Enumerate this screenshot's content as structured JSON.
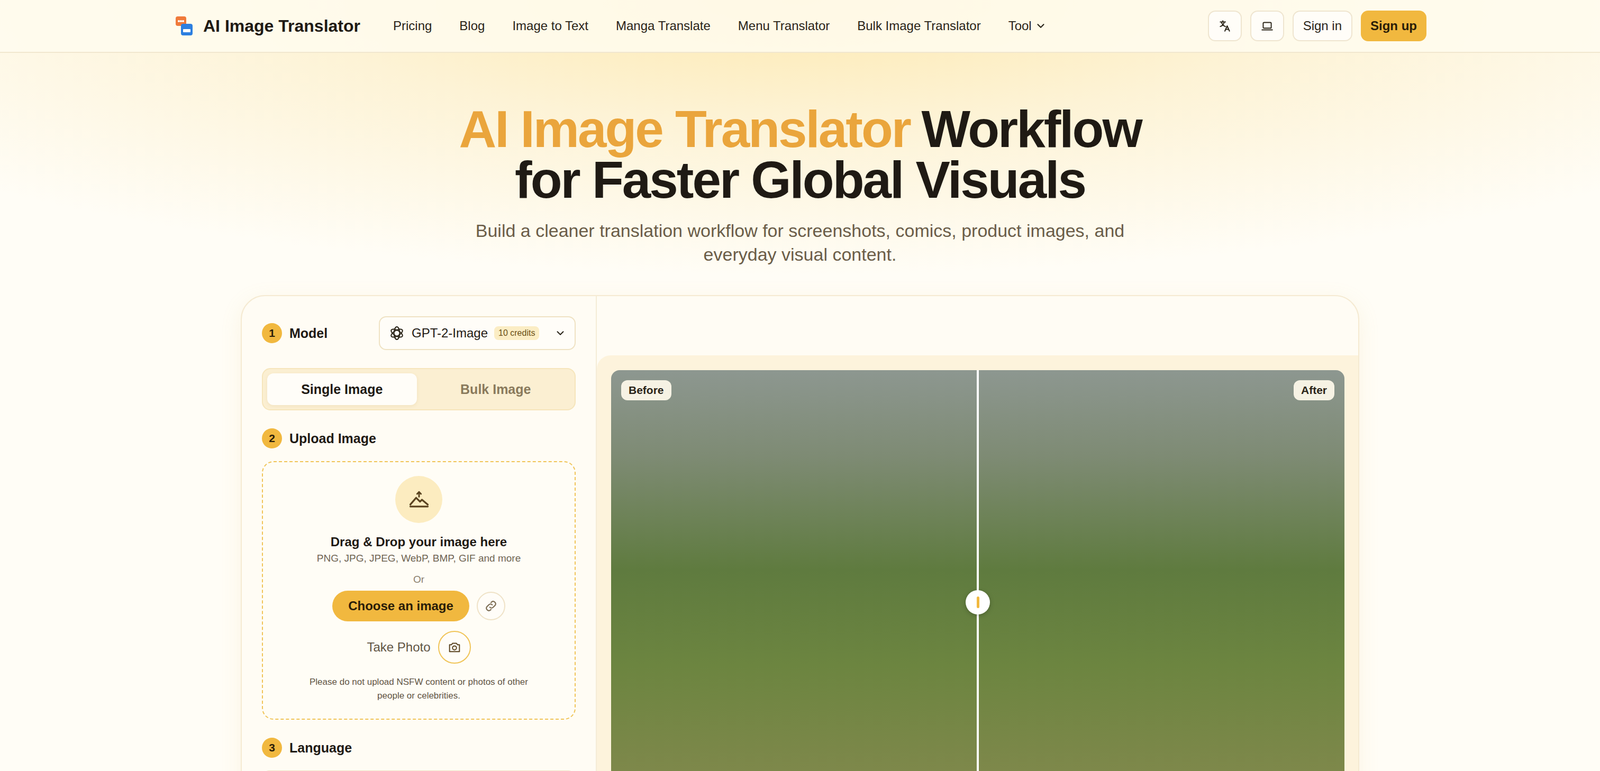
{
  "header": {
    "brand": "AI Image Translator",
    "nav": [
      "Pricing",
      "Blog",
      "Image to Text",
      "Manga Translate",
      "Menu Translator",
      "Bulk Image Translator"
    ],
    "tool_menu": "Tool",
    "sign_in": "Sign in",
    "sign_up": "Sign up"
  },
  "hero": {
    "title_highlight": "AI Image Translator",
    "title_rest": "Workflow",
    "title_line2": "for Faster Global Visuals",
    "subtitle": "Build a cleaner translation workflow for screenshots, comics, product images, and everyday visual content."
  },
  "model": {
    "step": "1",
    "label": "Model",
    "name": "GPT-2-Image",
    "credits": "10 credits"
  },
  "mode_tabs": [
    {
      "label": "Single Image",
      "selected": true
    },
    {
      "label": "Bulk Image",
      "selected": false
    }
  ],
  "upload": {
    "step": "2",
    "label": "Upload Image",
    "title": "Drag & Drop your image here",
    "formats": "PNG, JPG, JPEG, WebP, BMP, GIF and more",
    "or": "Or",
    "choose": "Choose an image",
    "take_photo": "Take Photo",
    "notice": "Please do not upload NSFW content or photos of other people or celebrities."
  },
  "language": {
    "step": "3",
    "label": "Language"
  },
  "compare": {
    "before": "Before",
    "after": "After",
    "level": 0.5
  }
}
